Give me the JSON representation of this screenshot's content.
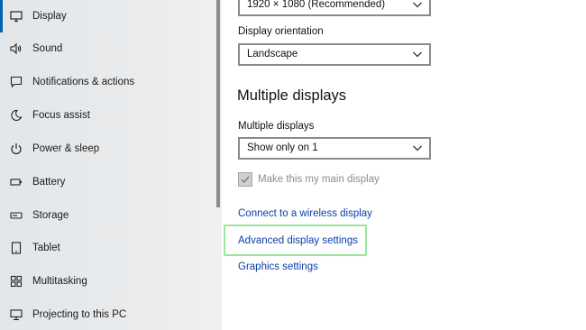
{
  "sidebar": {
    "items": [
      {
        "label": "Display",
        "icon": "monitor-icon",
        "active": true
      },
      {
        "label": "Sound",
        "icon": "speaker-icon"
      },
      {
        "label": "Notifications & actions",
        "icon": "message-icon"
      },
      {
        "label": "Focus assist",
        "icon": "moon-icon"
      },
      {
        "label": "Power & sleep",
        "icon": "power-icon"
      },
      {
        "label": "Battery",
        "icon": "battery-icon"
      },
      {
        "label": "Storage",
        "icon": "storage-icon"
      },
      {
        "label": "Tablet",
        "icon": "tablet-icon"
      },
      {
        "label": "Multitasking",
        "icon": "multitasking-icon"
      },
      {
        "label": "Projecting to this PC",
        "icon": "projecting-icon"
      }
    ],
    "accent_color": "#0063b1"
  },
  "main": {
    "resolution": {
      "value": "1920 × 1080 (Recommended)"
    },
    "orientation": {
      "label": "Display orientation",
      "value": "Landscape"
    },
    "multiple_displays_section": {
      "title": "Multiple displays",
      "label": "Multiple displays",
      "value": "Show only on 1"
    },
    "main_display_checkbox": {
      "label": "Make this my main display",
      "checked": true,
      "disabled": true
    },
    "links": {
      "wireless": "Connect to a wireless display",
      "advanced": "Advanced display settings",
      "graphics": "Graphics settings"
    },
    "link_color": "#0a3fa8",
    "highlight_color": "#97e79b"
  }
}
